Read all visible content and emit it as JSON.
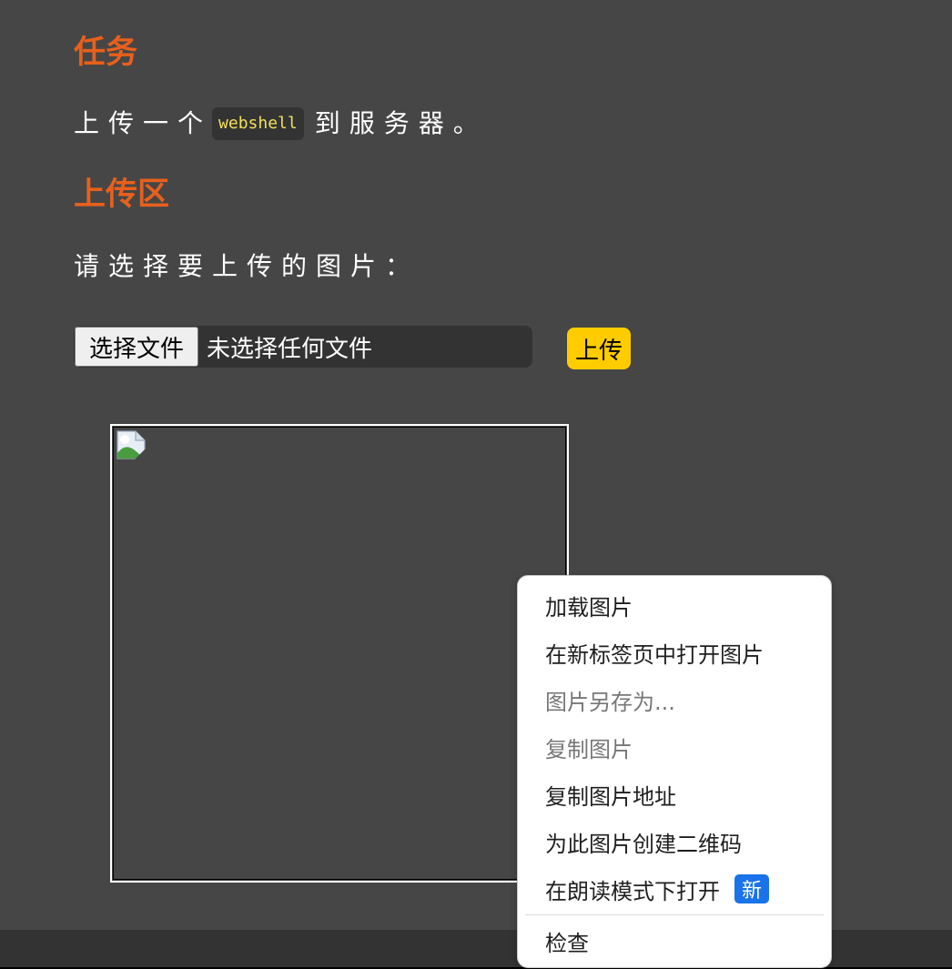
{
  "task": {
    "heading": "任务",
    "text_before": "上传一个",
    "code": "webshell",
    "text_after": "到服务器。"
  },
  "upload_area": {
    "heading": "上传区",
    "prompt": "请选择要上传的图片：",
    "choose_file_label": "选择文件",
    "file_status": "未选择任何文件",
    "upload_label": "上传"
  },
  "preview": {
    "image_state": "broken-image-icon"
  },
  "context_menu": {
    "items": [
      {
        "label": "加载图片",
        "enabled": true
      },
      {
        "label": "在新标签页中打开图片",
        "enabled": true
      },
      {
        "label": "图片另存为...",
        "enabled": false
      },
      {
        "label": "复制图片",
        "enabled": false
      },
      {
        "label": "复制图片地址",
        "enabled": true
      },
      {
        "label": "为此图片创建二维码",
        "enabled": true
      },
      {
        "label": "在朗读模式下打开",
        "enabled": true,
        "badge": "新"
      }
    ],
    "inspect_label": "检查"
  },
  "colors": {
    "background": "#464646",
    "heading": "#e8601c",
    "upload_button": "#ffcc00",
    "code_text": "#f1e05a",
    "badge": "#1a73e8"
  }
}
